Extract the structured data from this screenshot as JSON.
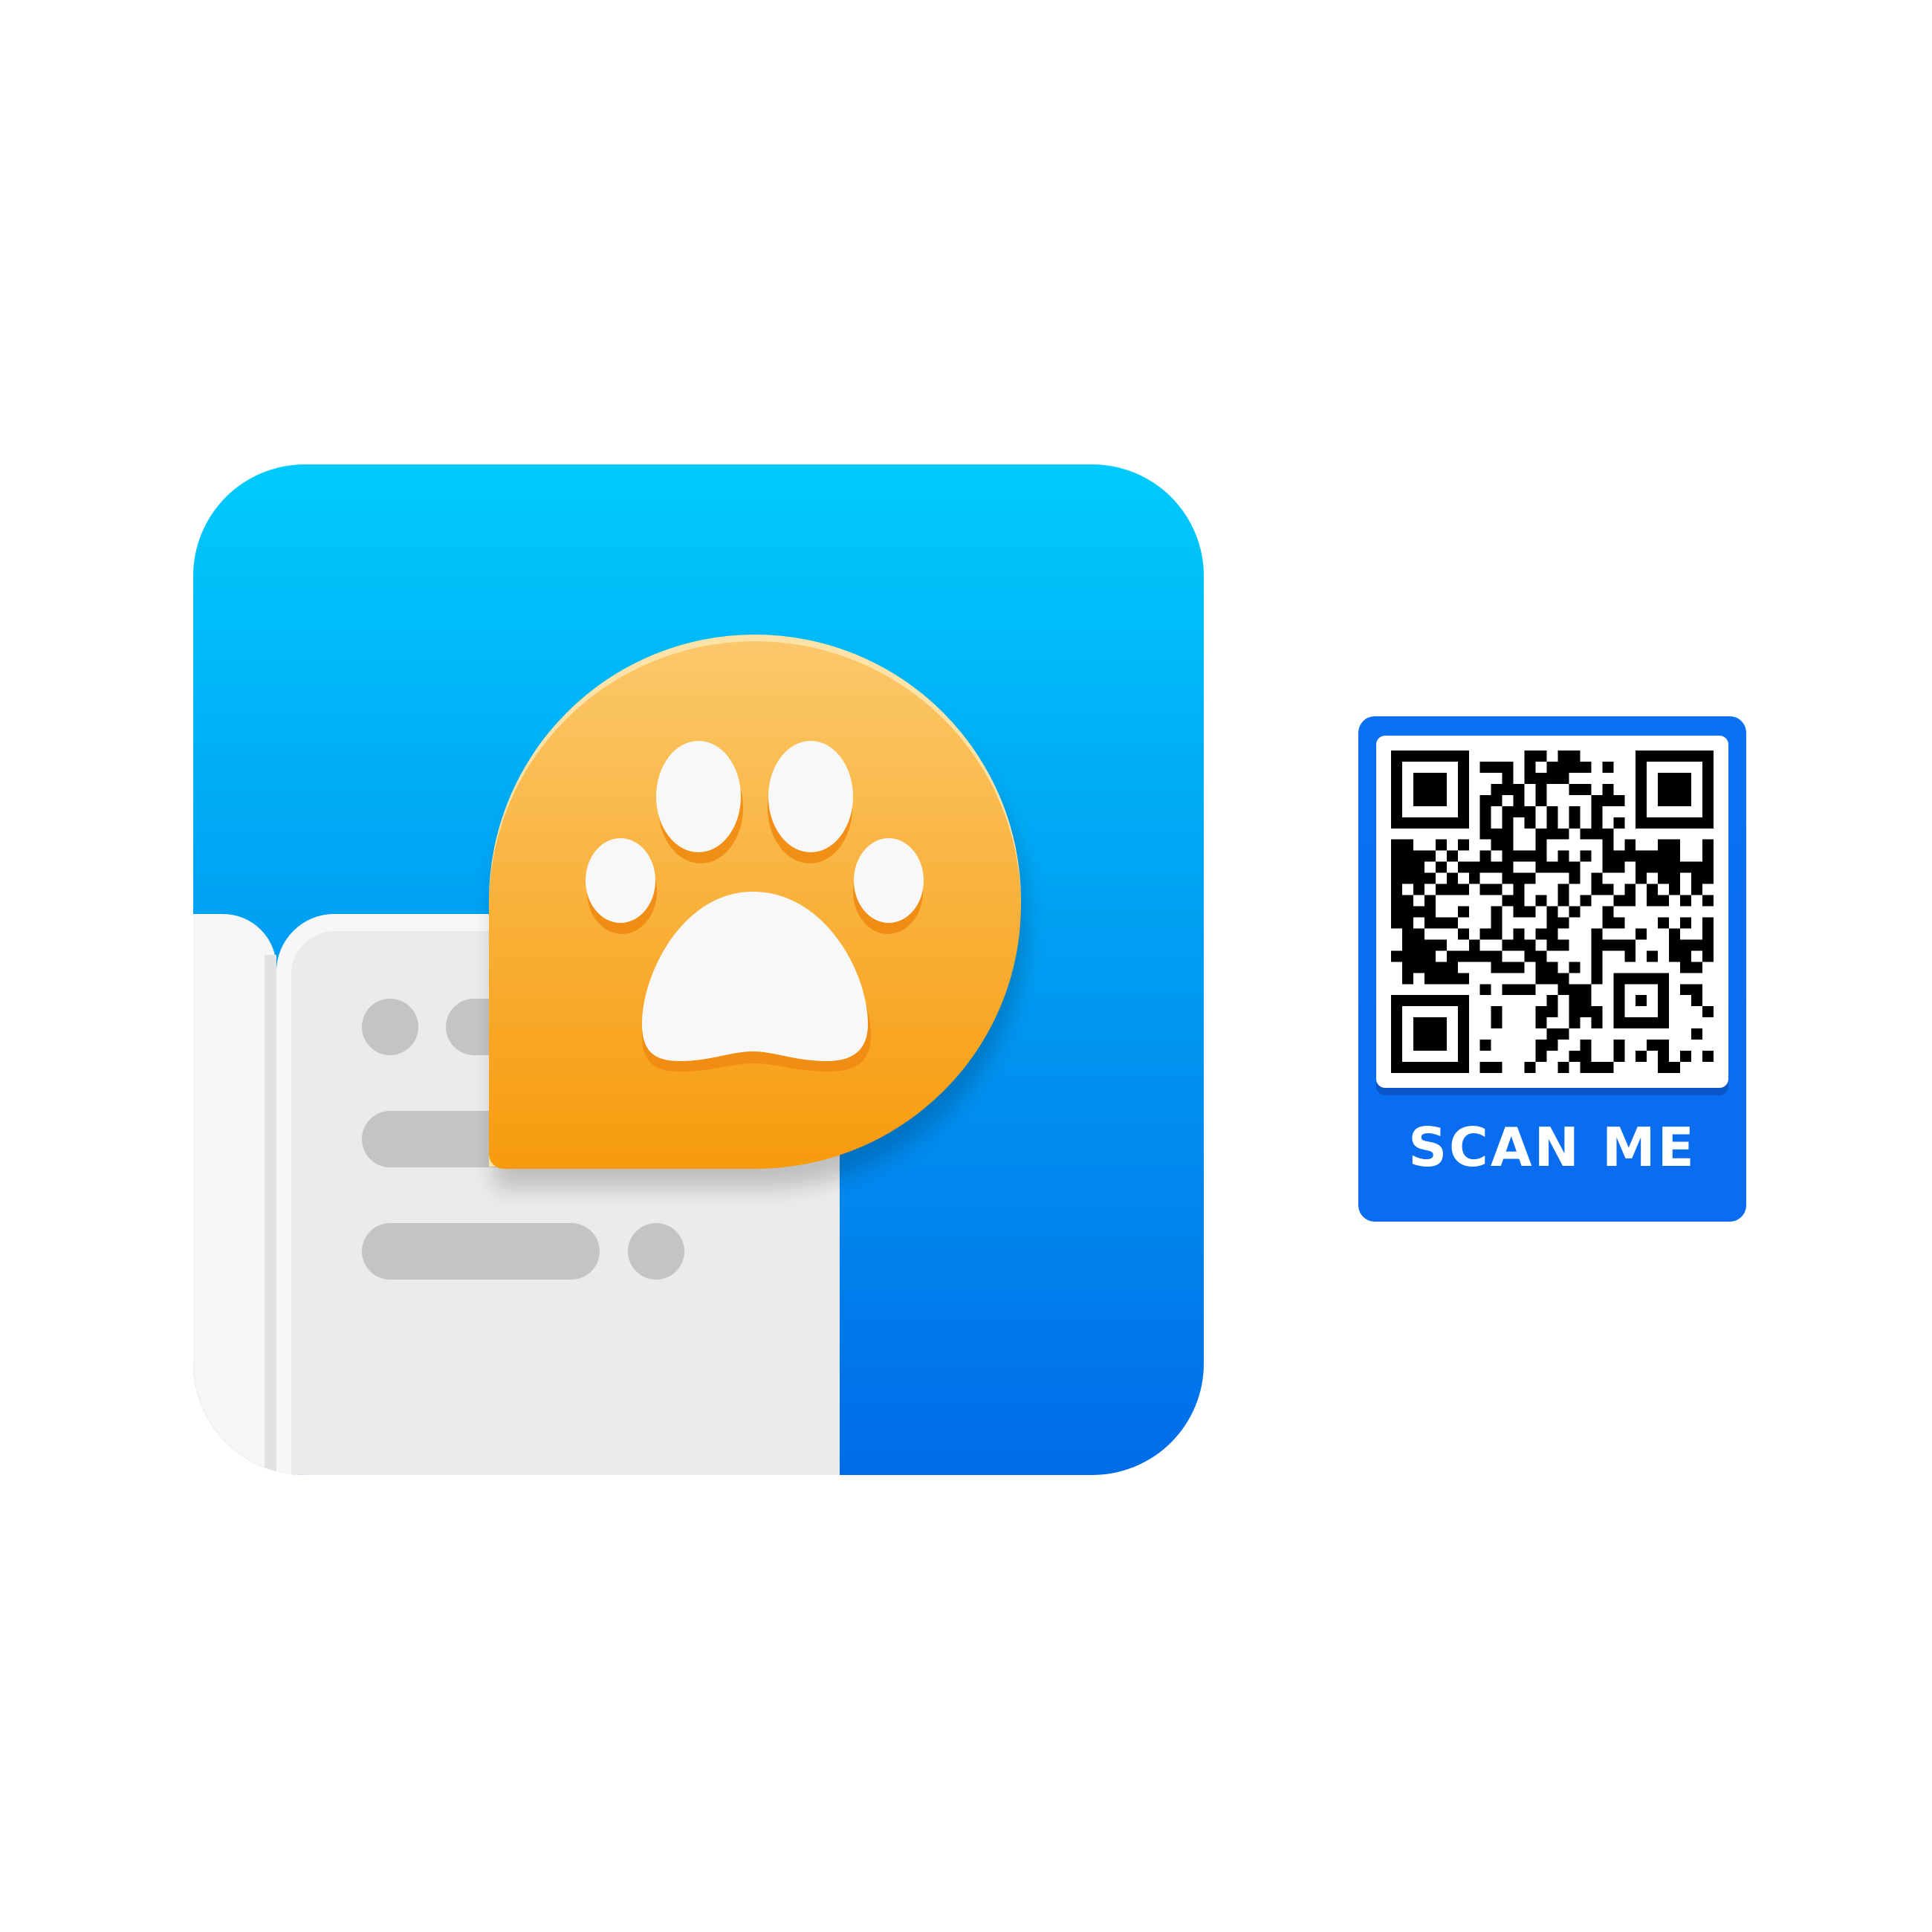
{
  "app_icon": {
    "name": "paw-chat-app-icon",
    "colors": {
      "background_top": "#00cbfc",
      "background_bottom": "#006ce8",
      "card": "#ebebeb",
      "card_lines": "#c4c4c4",
      "bubble_top": "#fbc86a",
      "bubble_bottom": "#f79b0c",
      "paw": "#f8f8f8"
    }
  },
  "qr_card": {
    "label": "SCAN ME",
    "colors": {
      "card": "#0a72f2",
      "frame": "#ffffff",
      "modules": "#000000"
    }
  }
}
